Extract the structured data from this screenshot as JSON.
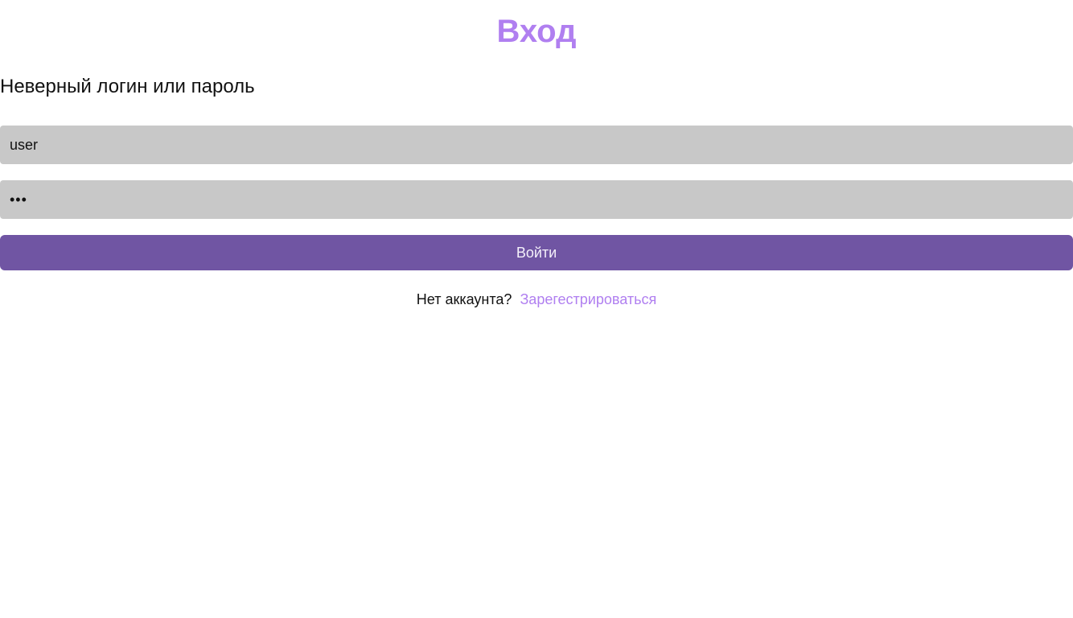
{
  "colors": {
    "accent": "#b07ff0",
    "button_bg": "#7055a3",
    "button_text": "#f4f0fa",
    "input_bg": "#c8c8c8"
  },
  "page": {
    "title": "Вход",
    "error_message": "Неверный логин или пароль"
  },
  "form": {
    "login_value": "user",
    "password_value": "•••",
    "submit_label": "Войти"
  },
  "footer": {
    "question": "Нет аккаунта?",
    "register_link": "Зарегестрироваться"
  }
}
